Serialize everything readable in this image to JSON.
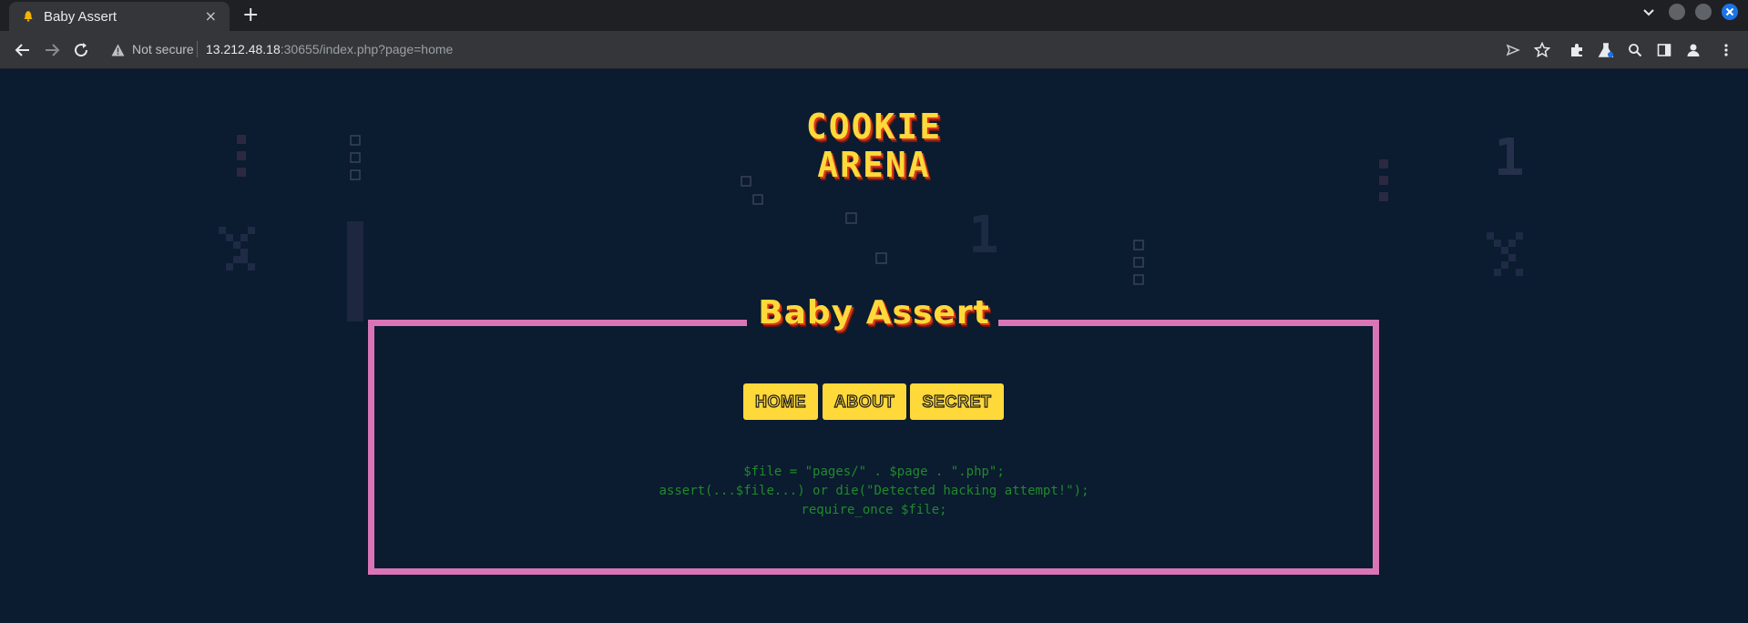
{
  "browser": {
    "tab_title": "Baby Assert",
    "tab_close": "×",
    "new_tab": "+",
    "security_label": "Not secure",
    "url_host": "13.212.48.18",
    "url_rest": ":30655/index.php?page=home"
  },
  "site": {
    "logo_line1": "COOKIE",
    "logo_line2": "ARENA",
    "challenge_title": "Baby Assert"
  },
  "nav": {
    "items": [
      "HOME",
      "ABOUT",
      "SECRET"
    ]
  },
  "code_lines": [
    "$file = \"pages/\" . $page . \".php\";",
    "assert(...$file...) or die(\"Detected hacking attempt!\");",
    "require_once $file;"
  ],
  "colors": {
    "accent_yellow": "#ffd93a",
    "frame_pink": "#d975b6",
    "page_bg": "#0b1b30",
    "code_green": "#1f8a2a"
  }
}
